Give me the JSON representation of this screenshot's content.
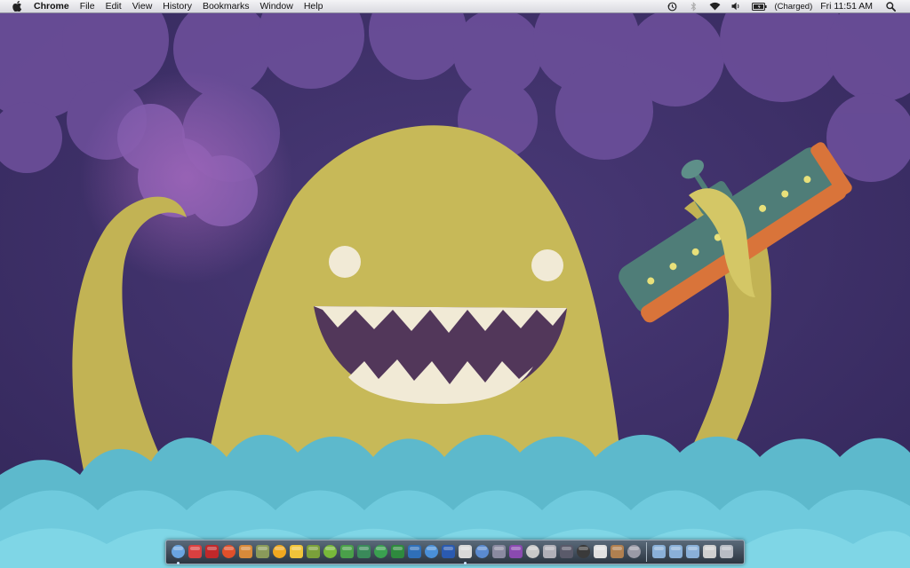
{
  "menubar": {
    "app_name": "Chrome",
    "menus": [
      "File",
      "Edit",
      "View",
      "History",
      "Bookmarks",
      "Window",
      "Help"
    ],
    "battery_status": "(Charged)",
    "clock": "Fri 11:51 AM",
    "status_icons": [
      "time-machine-icon",
      "bluetooth-icon",
      "wifi-icon",
      "volume-icon",
      "battery-icon",
      "spotlight-search-icon"
    ]
  },
  "desktop": {
    "wallpaper": "sea-monster-holding-submarine",
    "colors": {
      "sky": "#3b2d62",
      "cloud": "#7b5aa6",
      "monster": "#c4b656",
      "sea": "#67c7d9",
      "submarine": "#4f7d78",
      "hull": "#d9743a"
    }
  },
  "dock": {
    "apps": [
      {
        "name": "finder-icon",
        "color": "#6aa4e0"
      },
      {
        "name": "cleaner-app-icon",
        "color": "#d94040"
      },
      {
        "name": "flash-cards-icon",
        "color": "#c0282a"
      },
      {
        "name": "pages-icon",
        "color": "#e0502a"
      },
      {
        "name": "garageband-icon",
        "color": "#d88a3a"
      },
      {
        "name": "star-app-icon",
        "color": "#8a9a5a"
      },
      {
        "name": "orange-o-app-icon",
        "color": "#f0a820"
      },
      {
        "name": "adium-duck-icon",
        "color": "#f0c43a"
      },
      {
        "name": "dreamweaver-icon",
        "color": "#7aa03a"
      },
      {
        "name": "spotify-icon",
        "color": "#78b83a"
      },
      {
        "name": "evernote-icon",
        "color": "#4aa04a"
      },
      {
        "name": "stickies-app-icon",
        "color": "#3a8a5a"
      },
      {
        "name": "xcode-green-icon",
        "color": "#3aa050"
      },
      {
        "name": "excel-icon",
        "color": "#2e8a3e"
      },
      {
        "name": "photoshop-icon",
        "color": "#2f6fb8"
      },
      {
        "name": "app-store-icon",
        "color": "#4a90d8"
      },
      {
        "name": "word-icon",
        "color": "#2a5ab0"
      },
      {
        "name": "chrome-icon",
        "color": "#d8d8d8"
      },
      {
        "name": "alien-app-icon",
        "color": "#5a8ad0"
      },
      {
        "name": "mail-app-icon",
        "color": "#8a8aa0"
      },
      {
        "name": "purple-orb-icon",
        "color": "#8a4ab0"
      },
      {
        "name": "instruments-icon",
        "color": "#c8c8c8"
      },
      {
        "name": "preview-icon",
        "color": "#b0b0b8"
      },
      {
        "name": "pen-tool-icon",
        "color": "#5a5a6a"
      },
      {
        "name": "dashboard-icon",
        "color": "#3a3a3a"
      },
      {
        "name": "itunes-icon",
        "color": "#e0e0e0"
      },
      {
        "name": "books-icon",
        "color": "#b08050"
      },
      {
        "name": "system-preferences-icon",
        "color": "#9a9aa6"
      }
    ],
    "stacks": [
      {
        "name": "applications-folder-icon",
        "color": "#8ab0d8"
      },
      {
        "name": "documents-folder-icon",
        "color": "#8ab0d8"
      },
      {
        "name": "downloads-folder-icon",
        "color": "#8ab0d8"
      },
      {
        "name": "photo-stack-icon",
        "color": "#d0d0d0"
      },
      {
        "name": "trash-icon",
        "color": "#b8bcc4"
      }
    ]
  }
}
